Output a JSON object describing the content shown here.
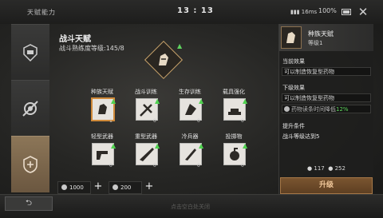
{
  "statusbar": {
    "title": "天赋能力",
    "time": "13 : 13",
    "signal": "16ms",
    "battery": "100%"
  },
  "tabs": [
    {
      "icon": "skill-tab-icon-1"
    },
    {
      "icon": "skill-tab-icon-2"
    },
    {
      "icon": "skill-tab-icon-3"
    }
  ],
  "main": {
    "title": "战斗天赋",
    "level_text": "战斗熟练度等级:145/8",
    "skills": [
      {
        "label": "种族天赋",
        "value": "1"
      },
      {
        "label": "战斗训练",
        "value": "0"
      },
      {
        "label": "生存训练",
        "value": "0"
      },
      {
        "label": "载具强化",
        "value": "0"
      },
      {
        "label": "轻型武器",
        "value": "0"
      },
      {
        "label": "重型武器",
        "value": "0"
      },
      {
        "label": "冷兵器",
        "value": "0"
      },
      {
        "label": "投掷物",
        "value": "0"
      }
    ],
    "resource1": "1000",
    "resource2": "200"
  },
  "right": {
    "name": "种族天赋",
    "level": "等级1",
    "current_label": "当前效果",
    "current_value": "可以制造恢复型药物",
    "next_label": "下级效果",
    "next_value": "可以制造恢复型药物",
    "next_bonus_text": "药物读条时间降低",
    "next_bonus_value": "12%",
    "req_label": "提升条件",
    "req_value": "战斗等级达到5",
    "cost1": "117",
    "cost2": "252",
    "upgrade_label": "升级"
  },
  "bottom": {
    "hint": "点击空白处关闭",
    "back_icon": "back-arrow-icon"
  },
  "colors": {
    "accent": "#d08a3a",
    "upgrade": "#6a4a2a",
    "green": "#5ed65e"
  }
}
